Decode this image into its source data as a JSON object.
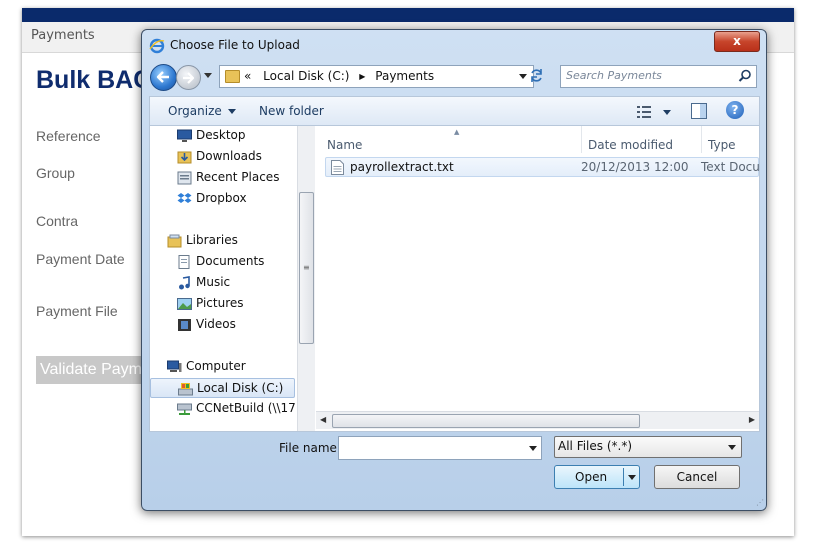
{
  "page": {
    "nav_item": "Payments",
    "title": "Bulk BACS",
    "labels": [
      "Reference",
      "Group",
      "Contra",
      "Payment Date",
      "Payment File"
    ],
    "validate_button": "Validate Payments"
  },
  "dialog": {
    "title": "Choose File to Upload",
    "close_label": "x",
    "address": {
      "overflow": "«",
      "crumbs": [
        "Local Disk (C:)",
        "Payments"
      ]
    },
    "search_placeholder": "Search Payments",
    "toolbar": {
      "organize": "Organize",
      "new_folder": "New folder",
      "help": "?"
    },
    "nav_items": [
      {
        "label": "Desktop",
        "icon": "desktop-icon"
      },
      {
        "label": "Downloads",
        "icon": "downloads-icon"
      },
      {
        "label": "Recent Places",
        "icon": "recent-places-icon"
      },
      {
        "label": "Dropbox",
        "icon": "dropbox-icon"
      },
      {
        "label": "Libraries",
        "icon": "libraries-icon"
      },
      {
        "label": "Documents",
        "icon": "documents-icon"
      },
      {
        "label": "Music",
        "icon": "music-icon"
      },
      {
        "label": "Pictures",
        "icon": "pictures-icon"
      },
      {
        "label": "Videos",
        "icon": "videos-icon"
      },
      {
        "label": "Computer",
        "icon": "computer-icon"
      },
      {
        "label": "Local Disk (C:)",
        "icon": "drive-icon",
        "selected": true
      },
      {
        "label": "CCNetBuild (\\\\17",
        "icon": "network-drive-icon"
      }
    ],
    "columns": [
      "Name",
      "Date modified",
      "Type"
    ],
    "files": [
      {
        "name": "payrollextract.txt",
        "date_modified": "20/12/2013 12:00",
        "type": "Text Docu"
      }
    ],
    "file_name_label": "File name:",
    "file_name_value": "",
    "file_type_label": "All Files (*.*)",
    "open_button": "Open",
    "cancel_button": "Cancel"
  },
  "colors": {
    "brand_navy": "#0a2a6b",
    "title_blue": "#0f2c6e",
    "dialog_frame": "#c4d8ee",
    "close_red": "#c7452b"
  }
}
